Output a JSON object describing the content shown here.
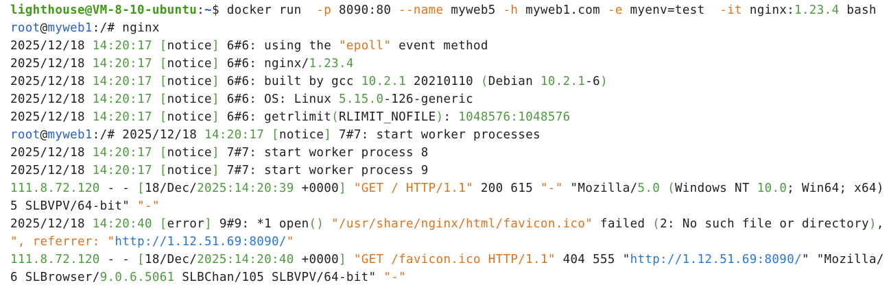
{
  "colors": {
    "background": "#ffffff",
    "text": "#1f1f1f",
    "green": "#4e9a3e",
    "blue": "#2660c9",
    "orange": "#e0731c",
    "bold_green": "#3f9a17",
    "link_blue": "#2a76d6"
  },
  "terminal": {
    "lines": [
      {
        "segments": [
          {
            "text": "lighthouse@VM-8-10-ubuntu",
            "color": "bold_green",
            "bold": true
          },
          {
            "text": ":",
            "color": "text"
          },
          {
            "text": "~",
            "color": "blue",
            "bold": true
          },
          {
            "text": "$ docker run  ",
            "color": "text"
          },
          {
            "text": "-p",
            "color": "orange"
          },
          {
            "text": " 8090:80 ",
            "color": "text"
          },
          {
            "text": "--name",
            "color": "orange"
          },
          {
            "text": " myweb5 ",
            "color": "text"
          },
          {
            "text": "-h",
            "color": "orange"
          },
          {
            "text": " myweb1.com ",
            "color": "text"
          },
          {
            "text": "-e",
            "color": "orange"
          },
          {
            "text": " myenv=test  ",
            "color": "text"
          },
          {
            "text": "-it",
            "color": "orange"
          },
          {
            "text": " nginx:",
            "color": "text"
          },
          {
            "text": "1.23.4",
            "color": "green"
          },
          {
            "text": " bash",
            "color": "text"
          }
        ]
      },
      {
        "segments": [
          {
            "text": "root",
            "color": "blue"
          },
          {
            "text": "@",
            "color": "text"
          },
          {
            "text": "myweb1",
            "color": "blue"
          },
          {
            "text": ":/# nginx",
            "color": "text"
          }
        ]
      },
      {
        "segments": [
          {
            "text": "2025/12/18 ",
            "color": "text"
          },
          {
            "text": "14:20:17",
            "color": "green"
          },
          {
            "text": " [",
            "color": "green"
          },
          {
            "text": "notice",
            "color": "text"
          },
          {
            "text": "]",
            "color": "green"
          },
          {
            "text": " 6#6: using the ",
            "color": "text"
          },
          {
            "text": "\"epoll\"",
            "color": "orange"
          },
          {
            "text": " event method",
            "color": "text"
          }
        ]
      },
      {
        "segments": [
          {
            "text": "2025/12/18 ",
            "color": "text"
          },
          {
            "text": "14:20:17",
            "color": "green"
          },
          {
            "text": " [",
            "color": "green"
          },
          {
            "text": "notice",
            "color": "text"
          },
          {
            "text": "]",
            "color": "green"
          },
          {
            "text": " 6#6: nginx/",
            "color": "text"
          },
          {
            "text": "1.23.4",
            "color": "green"
          }
        ]
      },
      {
        "segments": [
          {
            "text": "2025/12/18 ",
            "color": "text"
          },
          {
            "text": "14:20:17",
            "color": "green"
          },
          {
            "text": " [",
            "color": "green"
          },
          {
            "text": "notice",
            "color": "text"
          },
          {
            "text": "]",
            "color": "green"
          },
          {
            "text": " 6#6: built by gcc ",
            "color": "text"
          },
          {
            "text": "10.2.1",
            "color": "green"
          },
          {
            "text": " 20210110 ",
            "color": "text"
          },
          {
            "text": "(",
            "color": "green"
          },
          {
            "text": "Debian ",
            "color": "text"
          },
          {
            "text": "10.2.1",
            "color": "green"
          },
          {
            "text": "-6",
            "color": "text"
          },
          {
            "text": ")",
            "color": "green"
          }
        ]
      },
      {
        "segments": [
          {
            "text": "2025/12/18 ",
            "color": "text"
          },
          {
            "text": "14:20:17",
            "color": "green"
          },
          {
            "text": " [",
            "color": "green"
          },
          {
            "text": "notice",
            "color": "text"
          },
          {
            "text": "]",
            "color": "green"
          },
          {
            "text": " 6#6: OS: Linux ",
            "color": "text"
          },
          {
            "text": "5.15.0",
            "color": "green"
          },
          {
            "text": "-126-generic",
            "color": "text"
          }
        ]
      },
      {
        "segments": [
          {
            "text": "2025/12/18 ",
            "color": "text"
          },
          {
            "text": "14:20:17",
            "color": "green"
          },
          {
            "text": " [",
            "color": "green"
          },
          {
            "text": "notice",
            "color": "text"
          },
          {
            "text": "]",
            "color": "green"
          },
          {
            "text": " 6#6: getrlimit",
            "color": "text"
          },
          {
            "text": "(",
            "color": "green"
          },
          {
            "text": "RLIMIT_NOFILE",
            "color": "text"
          },
          {
            "text": ")",
            "color": "green"
          },
          {
            "text": ": ",
            "color": "text"
          },
          {
            "text": "1048576:1048576",
            "color": "green"
          }
        ]
      },
      {
        "segments": [
          {
            "text": "root",
            "color": "blue"
          },
          {
            "text": "@",
            "color": "text"
          },
          {
            "text": "myweb1",
            "color": "blue"
          },
          {
            "text": ":/# 2025/12/18 ",
            "color": "text"
          },
          {
            "text": "14:20:17",
            "color": "green"
          },
          {
            "text": " [",
            "color": "green"
          },
          {
            "text": "notice",
            "color": "text"
          },
          {
            "text": "]",
            "color": "green"
          },
          {
            "text": " 7#7: start worker processes",
            "color": "text"
          }
        ]
      },
      {
        "segments": [
          {
            "text": "2025/12/18 ",
            "color": "text"
          },
          {
            "text": "14:20:17",
            "color": "green"
          },
          {
            "text": " [",
            "color": "green"
          },
          {
            "text": "notice",
            "color": "text"
          },
          {
            "text": "]",
            "color": "green"
          },
          {
            "text": " 7#7: start worker process 8",
            "color": "text"
          }
        ]
      },
      {
        "segments": [
          {
            "text": "2025/12/18 ",
            "color": "text"
          },
          {
            "text": "14:20:17",
            "color": "green"
          },
          {
            "text": " [",
            "color": "green"
          },
          {
            "text": "notice",
            "color": "text"
          },
          {
            "text": "]",
            "color": "green"
          },
          {
            "text": " 7#7: start worker process 9",
            "color": "text"
          }
        ]
      },
      {
        "segments": [
          {
            "text": "111.8.72.120",
            "color": "green"
          },
          {
            "text": " - - ",
            "color": "text"
          },
          {
            "text": "[",
            "color": "green"
          },
          {
            "text": "18/Dec/",
            "color": "text"
          },
          {
            "text": "2025:14:20:39",
            "color": "green"
          },
          {
            "text": " +0000",
            "color": "text"
          },
          {
            "text": "]",
            "color": "green"
          },
          {
            "text": " ",
            "color": "text"
          },
          {
            "text": "\"GET / HTTP/1.1\"",
            "color": "orange"
          },
          {
            "text": " 200 615 ",
            "color": "text"
          },
          {
            "text": "\"-\"",
            "color": "orange"
          },
          {
            "text": " \"Mozilla/",
            "color": "text"
          },
          {
            "text": "5.0",
            "color": "green"
          },
          {
            "text": " ",
            "color": "text"
          },
          {
            "text": "(",
            "color": "green"
          },
          {
            "text": "Windows NT ",
            "color": "text"
          },
          {
            "text": "10.0",
            "color": "green"
          },
          {
            "text": "; Win64; x64)",
            "color": "text"
          }
        ]
      },
      {
        "segments": [
          {
            "text": "5 SLBVPV/64-bit\" ",
            "color": "text"
          },
          {
            "text": "\"-\"",
            "color": "orange"
          }
        ]
      },
      {
        "segments": [
          {
            "text": "2025/12/18 ",
            "color": "text"
          },
          {
            "text": "14:20:40",
            "color": "green"
          },
          {
            "text": " [",
            "color": "green"
          },
          {
            "text": "error",
            "color": "text"
          },
          {
            "text": "]",
            "color": "green"
          },
          {
            "text": " 9#9: *1 open",
            "color": "text"
          },
          {
            "text": "()",
            "color": "green"
          },
          {
            "text": " ",
            "color": "text"
          },
          {
            "text": "\"/usr/share/nginx/html/favicon.ico\"",
            "color": "orange"
          },
          {
            "text": " failed ",
            "color": "text"
          },
          {
            "text": "(",
            "color": "green"
          },
          {
            "text": "2: No such file or directory",
            "color": "text"
          },
          {
            "text": ")",
            "color": "green"
          },
          {
            "text": ",",
            "color": "text"
          }
        ]
      },
      {
        "segments": [
          {
            "text": "\", referrer: \"",
            "color": "orange"
          },
          {
            "text": "http://1.12.51.69:8090/",
            "color": "link_blue"
          },
          {
            "text": "\"",
            "color": "orange"
          }
        ]
      },
      {
        "segments": [
          {
            "text": "111.8.72.120",
            "color": "green"
          },
          {
            "text": " - - ",
            "color": "text"
          },
          {
            "text": "[",
            "color": "green"
          },
          {
            "text": "18/Dec/",
            "color": "text"
          },
          {
            "text": "2025:14:20:40",
            "color": "green"
          },
          {
            "text": " +0000",
            "color": "text"
          },
          {
            "text": "]",
            "color": "green"
          },
          {
            "text": " ",
            "color": "text"
          },
          {
            "text": "\"GET /favicon.ico HTTP/1.1\"",
            "color": "orange"
          },
          {
            "text": " 404 555 \"",
            "color": "text"
          },
          {
            "text": "http://1.12.51.69:8090/",
            "color": "link_blue"
          },
          {
            "text": "\" \"Mozilla/",
            "color": "text"
          }
        ]
      },
      {
        "segments": [
          {
            "text": "6 SLBrowser/",
            "color": "text"
          },
          {
            "text": "9.0.6.5061",
            "color": "green"
          },
          {
            "text": " SLBChan/105 SLBVPV/64-bit\" ",
            "color": "text"
          },
          {
            "text": "\"-\"",
            "color": "orange"
          }
        ]
      }
    ]
  }
}
